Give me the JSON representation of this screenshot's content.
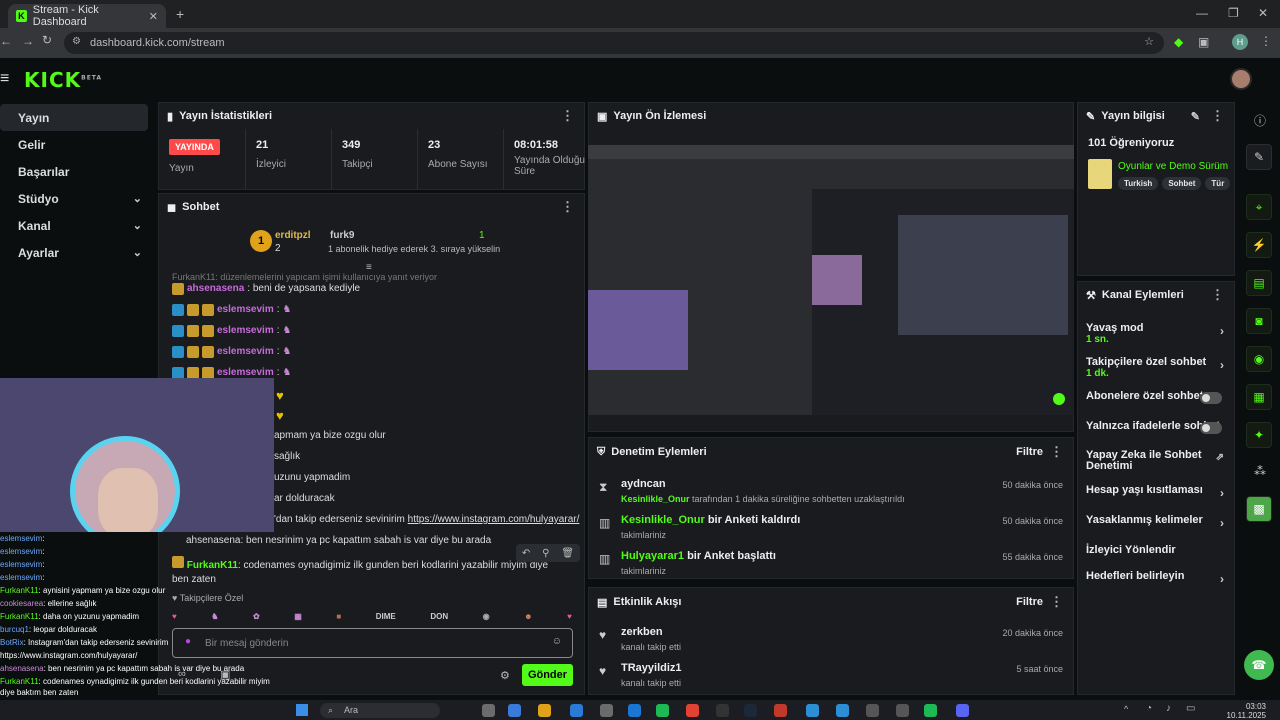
{
  "browser": {
    "tab_title": "Stream - Kick Dashboard",
    "url": "dashboard.kick.com/stream",
    "avatar_initial": "H"
  },
  "app": {
    "logo": "KICK",
    "logo_sup": "BETA"
  },
  "sidebar": {
    "items": [
      {
        "label": "Yayın"
      },
      {
        "label": "Gelir"
      },
      {
        "label": "Başarılar"
      },
      {
        "label": "Stüdyo"
      },
      {
        "label": "Kanal"
      },
      {
        "label": "Ayarlar"
      }
    ]
  },
  "stats": {
    "title": "Yayın İstatistikleri",
    "live_badge": "YAYINDA",
    "live_label": "Yayın",
    "items": [
      {
        "value": "21",
        "label": "İzleyici"
      },
      {
        "value": "349",
        "label": "Takipçi"
      },
      {
        "value": "23",
        "label": "Abone Sayısı"
      },
      {
        "value": "08:01:58",
        "label": "Yayında Olduğu Süre"
      }
    ]
  },
  "chat": {
    "title": "Sohbet",
    "pinned_user1": "erditpzl",
    "pinned_user1_count": "2",
    "pinned_user2": "furk9",
    "pinned_user2_count": "1",
    "pinned_note": "1 abonelik hediye ederek 3. sıraya yükselin",
    "top_line": "FurkanK11: düzenlemelerini yapıcam işimi kullanıcıya yanıt veriyor",
    "messages": [
      {
        "user": "ahsenasena",
        "text": ": beni de yapsana kediyle"
      },
      {
        "user": "eslemsevim",
        "text": ":"
      },
      {
        "user": "eslemsevim",
        "text": ":"
      },
      {
        "user": "eslemsevim",
        "text": ":"
      },
      {
        "user": "eslemsevim",
        "text": ":"
      }
    ],
    "partial_lines": [
      "apmam ya bize ozgu olur",
      "sağlık",
      "uzunu yapmadim",
      "ar dolduracak",
      "'dan takip ederseniz sevinirim",
      "ahsenasena: ben nesrinim ya pc kapattım sabah is var diye bu arada"
    ],
    "link": "https://www.instagram.com/hulyayarar/",
    "last_user": "FurkanK11",
    "last_text": ": codenames oynadigimiz ilk gunden beri kodlarini yazabilir miyim diye",
    "last_text2": "ben zaten",
    "followers_only": "Takipçilere Özel",
    "emotes": [
      "DIME",
      "DON"
    ],
    "input_placeholder": "Bir mesaj gönderin",
    "send": "Gönder"
  },
  "overlay_chat": [
    {
      "user": "eslemsevim",
      "text": ":"
    },
    {
      "user": "eslemsevim",
      "text": ":"
    },
    {
      "user": "eslemsevim",
      "text": ":"
    },
    {
      "user": "eslemsevim",
      "text": ":"
    },
    {
      "user": "FurkanK11",
      "text": ": aynisini yapmam ya bize ozgu olur"
    },
    {
      "user": "cookiesarea",
      "text": ": ellerine sağlık"
    },
    {
      "user": "FurkanK11",
      "text": ": daha on yuzunu yapmadim"
    },
    {
      "user": "burcuq1",
      "text": ": leopar dolduracak"
    },
    {
      "user": "BotRix",
      "text": ": Instagram'dan takip ederseniz sevinirim"
    },
    {
      "user": "https://www.instagram.com/hulyayarar/",
      "text": ""
    },
    {
      "user": "ahsenasena",
      "text": ": ben nesrinim ya pc kapattım sabah is var diye bu arada"
    },
    {
      "user": "FurkanK11",
      "text": ": codenames oynadigimiz ilk gunden beri kodlarini yazabilir miyim"
    },
    {
      "user": "diye baktım ben zaten",
      "text": ""
    }
  ],
  "preview": {
    "title": "Yayın Ön İzlemesi"
  },
  "moderation": {
    "title": "Denetim Eylemleri",
    "filter": "Filtre",
    "items": [
      {
        "name": "aydncan",
        "detail_user": "Kesinlikle_Onur",
        "detail": "tarafından 1 dakika süreliğine sohbetten uzaklaştırıldı",
        "time": "50 dakika önce"
      },
      {
        "name": "Kesinlikle_Onur",
        "action": "bir Anketi kaldırdı",
        "detail": "takimlariniz",
        "time": "50 dakika önce"
      },
      {
        "name": "Hulyayarar1",
        "action": "bir Anket başlattı",
        "detail": "takimlariniz",
        "time": "55 dakika önce"
      }
    ]
  },
  "activity": {
    "title": "Etkinlik Akışı",
    "filter": "Filtre",
    "items": [
      {
        "name": "zerkben",
        "detail": "kanalı takip etti",
        "time": "20 dakika önce"
      },
      {
        "name": "TRayyildiz1",
        "detail": "kanalı takip etti",
        "time": "5 saat önce"
      }
    ]
  },
  "stream_info": {
    "title": "Yayın bilgisi",
    "stream_title": "101 Öğreniyoruz",
    "category": "Oyunlar ve Demo Sürüm",
    "tags": [
      "Turkish",
      "Sohbet",
      "Tür"
    ]
  },
  "channel_actions": {
    "title": "Kanal Eylemleri",
    "items": [
      {
        "label": "Yavaş mod",
        "sub": "1 sn.",
        "kind": "chevron"
      },
      {
        "label": "Takipçilere özel sohbet",
        "sub": "1 dk.",
        "kind": "chevron"
      },
      {
        "label": "Abonelere özel sohbet",
        "sub": "",
        "kind": "toggle"
      },
      {
        "label": "Yalnızca ifadelerle sohbet",
        "sub": "",
        "kind": "toggle"
      },
      {
        "label": "Yapay Zeka ile Sohbet Denetimi",
        "sub": "",
        "kind": "external"
      },
      {
        "label": "Hesap yaşı kısıtlaması",
        "sub": "",
        "kind": "chevron"
      },
      {
        "label": "Yasaklanmış kelimeler",
        "sub": "",
        "kind": "chevron"
      },
      {
        "label": "İzleyici Yönlendir",
        "sub": "",
        "kind": "none"
      },
      {
        "label": "Hedefleri belirleyin",
        "sub": "",
        "kind": "chevron"
      }
    ]
  },
  "taskbar": {
    "search": "Ara",
    "time": "03:03",
    "date": "10.11.2025"
  },
  "colors": {
    "accent": "#53fc18",
    "live": "#ff4a4a",
    "panel": "#191b1f"
  }
}
